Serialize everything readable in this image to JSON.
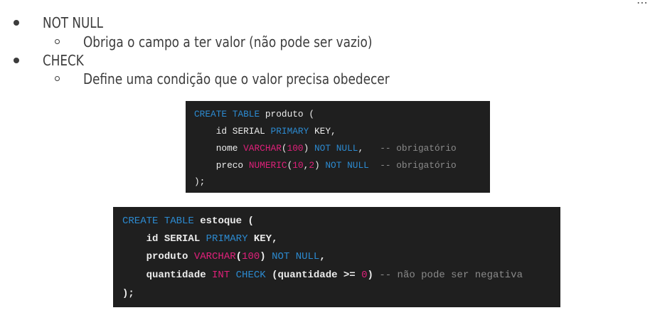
{
  "menu": {
    "more_icon": "⋯"
  },
  "bullets": [
    {
      "level": 1,
      "text": "NOT NULL"
    },
    {
      "level": 2,
      "text": "Obriga o campo a ter valor (não pode ser vazio)"
    },
    {
      "level": 1,
      "text": "CHECK"
    },
    {
      "level": 2,
      "text": "Define uma condição que o valor precisa obedecer"
    }
  ],
  "code_produto": {
    "lines": [
      "CREATE TABLE produto (",
      "    id SERIAL PRIMARY KEY,",
      "    nome VARCHAR(100) NOT NULL,   -- obrigatório",
      "    preco NUMERIC(10,2) NOT NULL  -- obrigatório",
      ");"
    ]
  },
  "code_estoque": {
    "lines": [
      "CREATE TABLE estoque (",
      "    id SERIAL PRIMARY KEY,",
      "    produto VARCHAR(100) NOT NULL,",
      "    quantidade INT CHECK (quantidade >= 0) -- não pode ser negativa",
      ");"
    ]
  },
  "colors": {
    "keyword": "#2c8ad0",
    "type": "#e0207a",
    "comment": "#8a8a8a",
    "code_bg": "#1f1f1f"
  }
}
